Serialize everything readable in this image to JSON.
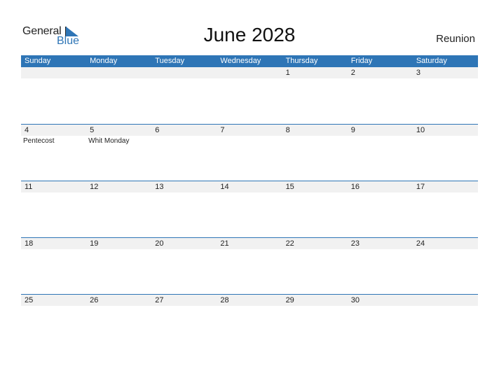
{
  "logo": {
    "general": "General",
    "blue": "Blue"
  },
  "title": "June 2028",
  "country": "Reunion",
  "colors": {
    "accent": "#2e75b6",
    "date_strip": "#f1f1f1"
  },
  "weekdays": [
    "Sunday",
    "Monday",
    "Tuesday",
    "Wednesday",
    "Thursday",
    "Friday",
    "Saturday"
  ],
  "weeks": [
    {
      "dates": [
        "",
        "",
        "",
        "",
        "1",
        "2",
        "3"
      ],
      "events": [
        "",
        "",
        "",
        "",
        "",
        "",
        ""
      ]
    },
    {
      "dates": [
        "4",
        "5",
        "6",
        "7",
        "8",
        "9",
        "10"
      ],
      "events": [
        "Pentecost",
        "Whit Monday",
        "",
        "",
        "",
        "",
        ""
      ]
    },
    {
      "dates": [
        "11",
        "12",
        "13",
        "14",
        "15",
        "16",
        "17"
      ],
      "events": [
        "",
        "",
        "",
        "",
        "",
        "",
        ""
      ]
    },
    {
      "dates": [
        "18",
        "19",
        "20",
        "21",
        "22",
        "23",
        "24"
      ],
      "events": [
        "",
        "",
        "",
        "",
        "",
        "",
        ""
      ]
    },
    {
      "dates": [
        "25",
        "26",
        "27",
        "28",
        "29",
        "30",
        ""
      ],
      "events": [
        "",
        "",
        "",
        "",
        "",
        "",
        ""
      ]
    }
  ]
}
